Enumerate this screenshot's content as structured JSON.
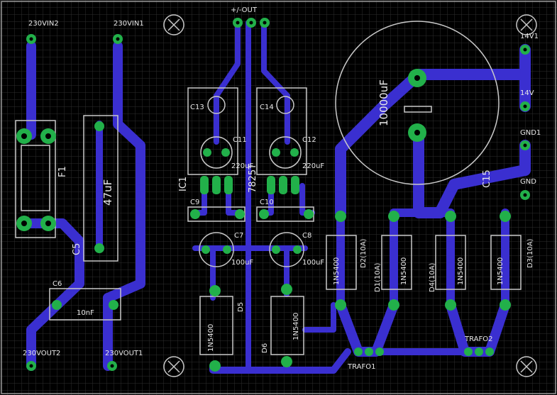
{
  "board": {
    "colors": {
      "background": "#000000",
      "grid": "#2e2e2e",
      "copper": "#3a2fd0",
      "pad": "#22b04a",
      "silk": "#c9c9c9",
      "text": "#e8e8e8"
    },
    "connectors": {
      "out": "+/-OUT",
      "vin2": "230VIN2",
      "vin1": "230VIN1",
      "vout2": "230VOUT2",
      "vout1": "230VOUT1",
      "v14_1": "14V1",
      "v14": "14V",
      "gnd1": "GND1",
      "gnd": "GND",
      "trafo1": "TRAFO1",
      "trafo2": "TRAFO2"
    },
    "parts": {
      "fuse": "F1",
      "c5": "C5",
      "c5_value": "47uF",
      "c6": "C6",
      "c6_value": "10nF",
      "ic1": "IC1",
      "ic_part": "7825T",
      "c13": "C13",
      "c14": "C14",
      "c11": "C11",
      "c12": "C12",
      "c11_value": "220uF",
      "c12_value": "220uF",
      "c9": "C9",
      "c10": "C10",
      "c7": "C7",
      "c8": "C8",
      "c7_value": "100uF",
      "c8_value": "100uF",
      "d5": "D5",
      "d6": "D6",
      "d5_part": "1N5400",
      "d6_part": "1N5400",
      "c15": "C15",
      "c15_value": "10000uF",
      "d1": "D1(10A)",
      "d2": "D2(10A)",
      "d3": "D3(10A)",
      "d4": "D4(10A)",
      "d1_part": "1N5400",
      "d2_part": "1N5400",
      "d3_part": "1N5400",
      "d4_part": "1N5400"
    }
  }
}
